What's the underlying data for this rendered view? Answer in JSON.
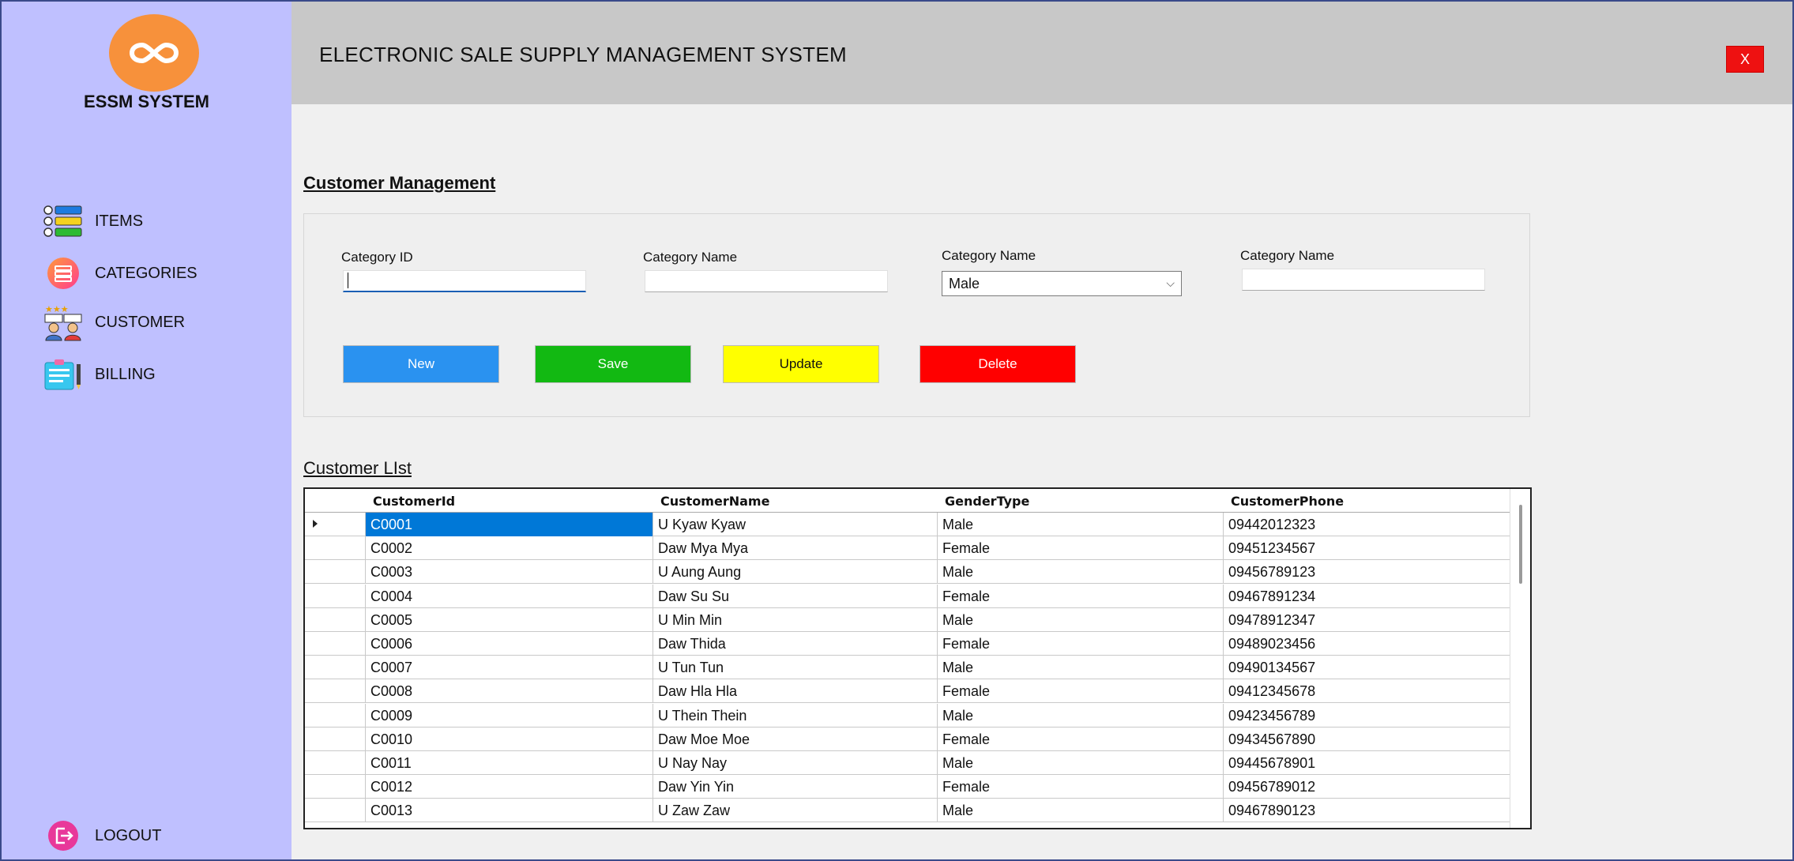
{
  "app": {
    "logo_text": "ESSM SYSTEM",
    "title": "ELECTRONIC SALE SUPPLY MANAGEMENT SYSTEM",
    "close_label": "X"
  },
  "sidebar": {
    "items": [
      {
        "label": "ITEMS",
        "icon": "list-icon"
      },
      {
        "label": "CATEGORIES",
        "icon": "categories-icon"
      },
      {
        "label": "CUSTOMER",
        "icon": "customer-icon"
      },
      {
        "label": "BILLING",
        "icon": "billing-icon"
      }
    ],
    "logout_label": "LOGOUT"
  },
  "form": {
    "section_title": "Customer Management",
    "label_1": "Category ID",
    "label_2": "Category Name",
    "label_3": "Category Name",
    "label_4": "Category Name",
    "input_1_value": "",
    "input_2_value": "",
    "gender_selected": "Male",
    "input_4_value": "",
    "buttons": {
      "new": "New",
      "save": "Save",
      "update": "Update",
      "delete": "Delete"
    }
  },
  "list": {
    "title": "Customer LIst",
    "columns": [
      "CustomerId",
      "CustomerName",
      "GenderType",
      "CustomerPhone"
    ],
    "rows": [
      [
        "C0001",
        "U Kyaw Kyaw",
        "Male",
        "09442012323"
      ],
      [
        "C0002",
        "Daw Mya Mya",
        "Female",
        "09451234567"
      ],
      [
        "C0003",
        "U Aung Aung",
        "Male",
        "09456789123"
      ],
      [
        "C0004",
        "Daw Su Su",
        "Female",
        "09467891234"
      ],
      [
        "C0005",
        "U Min Min",
        "Male",
        "09478912347"
      ],
      [
        "C0006",
        "Daw Thida",
        "Female",
        "09489023456"
      ],
      [
        "C0007",
        "U Tun Tun",
        "Male",
        "09490134567"
      ],
      [
        "C0008",
        "Daw Hla Hla",
        "Female",
        "09412345678"
      ],
      [
        "C0009",
        "U Thein Thein",
        "Male",
        "09423456789"
      ],
      [
        "C0010",
        "Daw Moe Moe",
        "Female",
        "09434567890"
      ],
      [
        "C0011",
        "U Nay Nay",
        "Male",
        "09445678901"
      ],
      [
        "C0012",
        "Daw Yin Yin",
        "Female",
        "09456789012"
      ],
      [
        "C0013",
        "U Zaw Zaw",
        "Male",
        "09467890123"
      ]
    ]
  },
  "colors": {
    "sidebar_bg": "#bfc0ff",
    "header_bg": "#c8c8c8",
    "logo": "#f7913b",
    "new_btn": "#2a92f0",
    "save_btn": "#12b912",
    "update_btn": "#ffff00",
    "delete_btn": "#ff0000",
    "selection": "#0078d7"
  }
}
